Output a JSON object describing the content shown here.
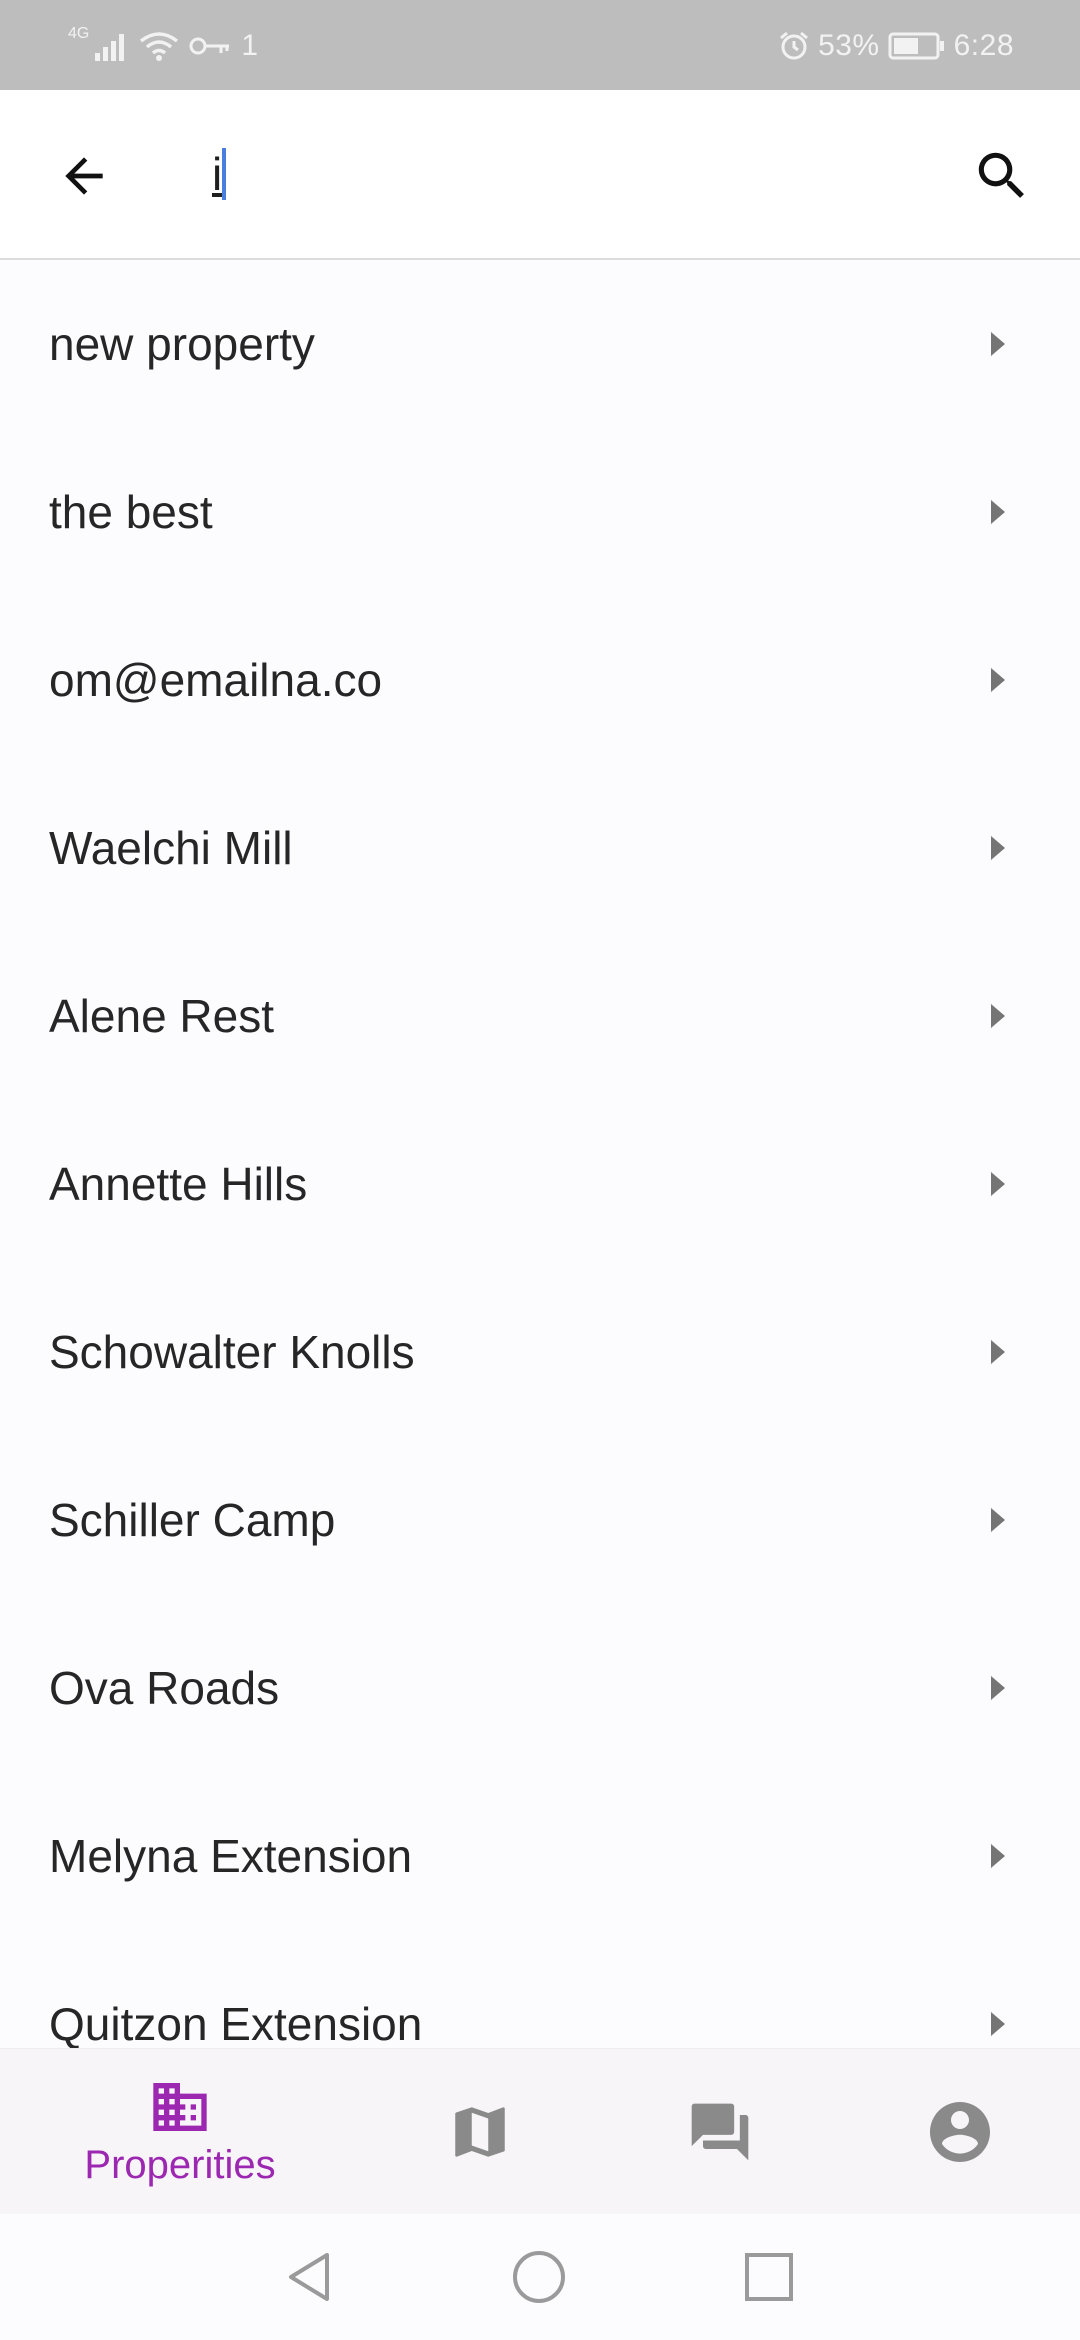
{
  "status_bar": {
    "network_label": "4G",
    "data_label": "1",
    "battery_percent": "53%",
    "time": "6:28"
  },
  "search": {
    "query": "i",
    "back_icon": "arrow-back-icon",
    "search_icon": "search-icon"
  },
  "results": [
    {
      "label": "new property"
    },
    {
      "label": "the best"
    },
    {
      "label": "om@emailna.co"
    },
    {
      "label": "Waelchi Mill"
    },
    {
      "label": "Alene Rest"
    },
    {
      "label": "Annette Hills"
    },
    {
      "label": "Schowalter Knolls"
    },
    {
      "label": "Schiller Camp"
    },
    {
      "label": "Ova Roads"
    },
    {
      "label": "Melyna Extension"
    },
    {
      "label": "Quitzon Extension"
    }
  ],
  "bottom_nav": {
    "items": [
      {
        "label": "Properities",
        "icon": "building-icon",
        "active": true
      },
      {
        "label": "",
        "icon": "map-icon",
        "active": false
      },
      {
        "label": "",
        "icon": "forum-icon",
        "active": false
      },
      {
        "label": "",
        "icon": "account-circle-icon",
        "active": false
      }
    ]
  },
  "colors": {
    "accent": "#9c27b0",
    "inactive_icon": "#8a8a8a",
    "caret": "#4a7fe0",
    "status_bar_bg": "#bdbdbd"
  }
}
